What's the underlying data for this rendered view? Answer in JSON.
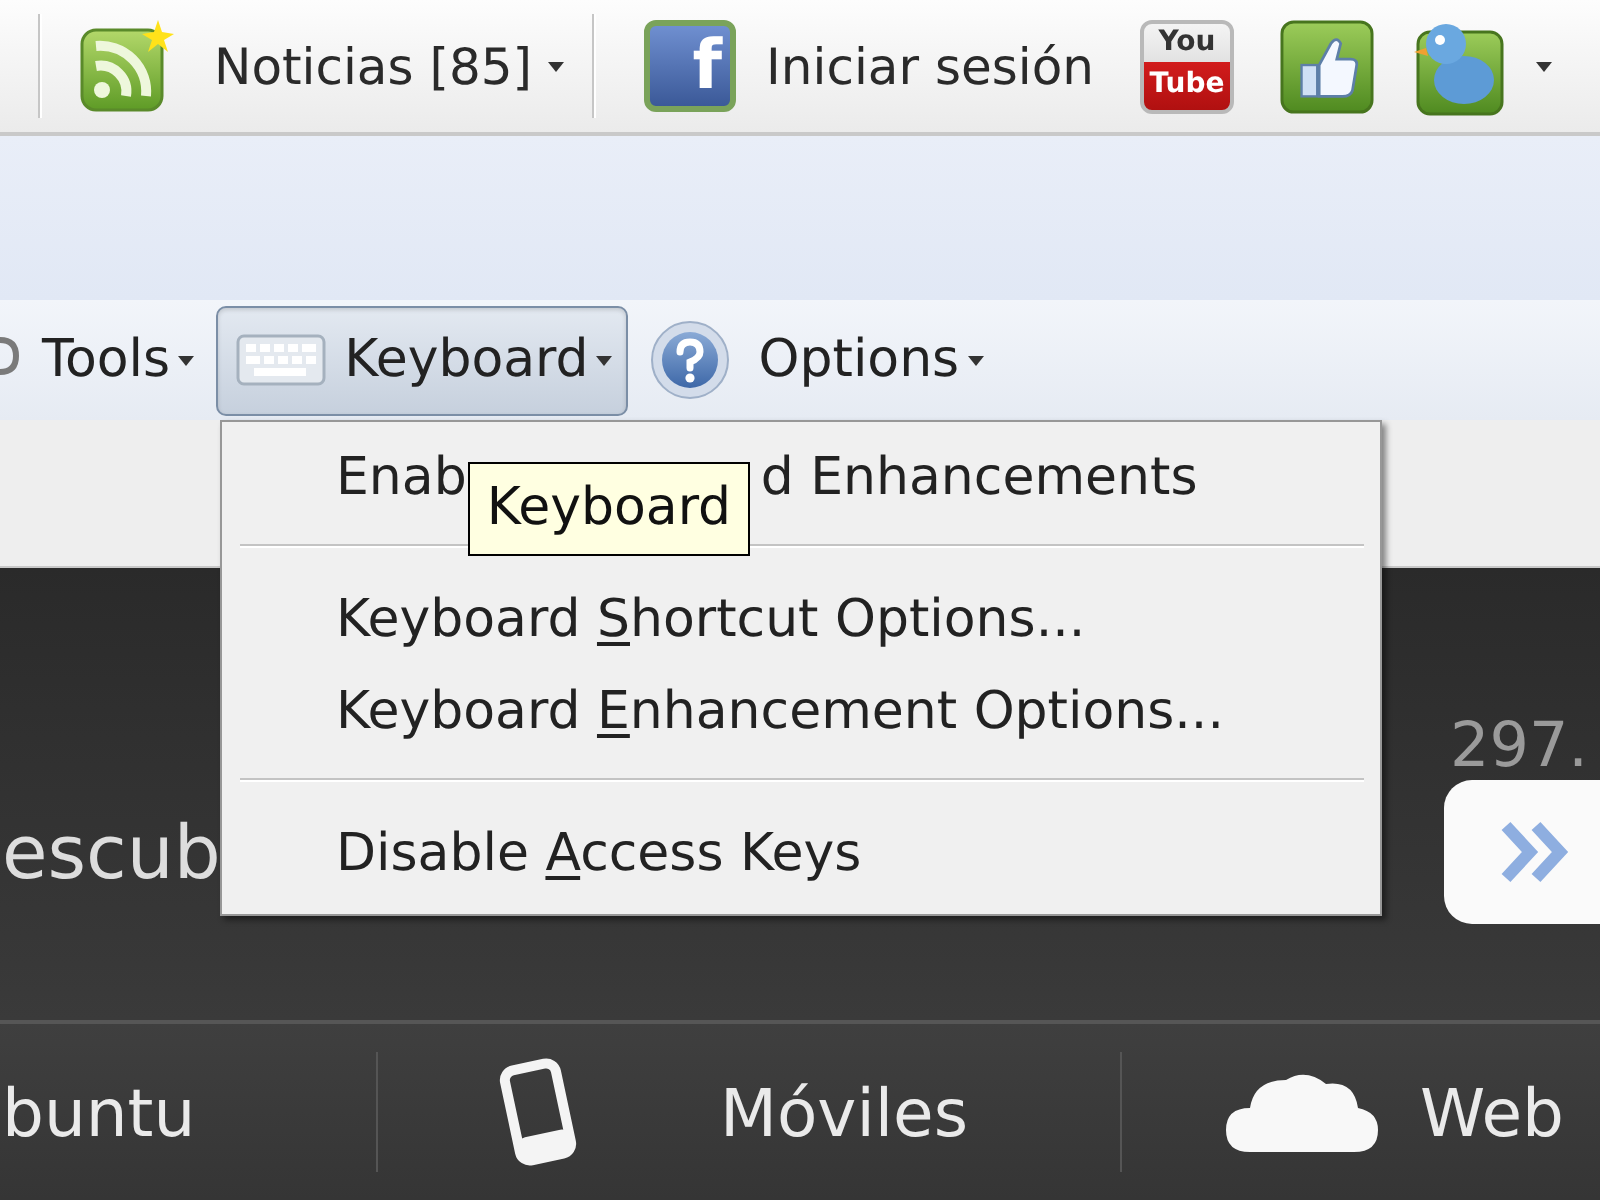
{
  "top_toolbar": {
    "news_button": {
      "label": "Noticias [85]"
    },
    "facebook_logo": {
      "text": "f"
    },
    "login_button": {
      "label": "Iniciar sesión"
    },
    "youtube_logo": {
      "lines": [
        "You",
        "Tube"
      ]
    }
  },
  "toolbar": {
    "buttons": [
      {
        "label": "Tools",
        "pressed": false
      },
      {
        "label": "Keyboard",
        "pressed": true
      },
      {
        "label": "Options",
        "pressed": false
      }
    ]
  },
  "menu": {
    "items": [
      {
        "kind": "partly_hidden",
        "text_before": "Enab",
        "text_after": "d Enhancements"
      },
      {
        "kind": "separator"
      },
      {
        "kind": "item",
        "text_before": "Keyboard ",
        "access_key": "S",
        "text_after": "hortcut Options..."
      },
      {
        "kind": "item",
        "text_before": "Keyboard ",
        "access_key": "E",
        "text_after": "nhancement Options..."
      },
      {
        "kind": "separator"
      },
      {
        "kind": "item",
        "text_before": "Disable ",
        "access_key": "A",
        "text_after": "ccess Keys"
      }
    ]
  },
  "tooltip": {
    "text": "Keyboard"
  },
  "hero": {
    "counter": "297.",
    "heading": "escub"
  },
  "nav": {
    "items": [
      {
        "label": "buntu"
      },
      {
        "label": "Móviles"
      },
      {
        "label": "Web"
      }
    ]
  }
}
